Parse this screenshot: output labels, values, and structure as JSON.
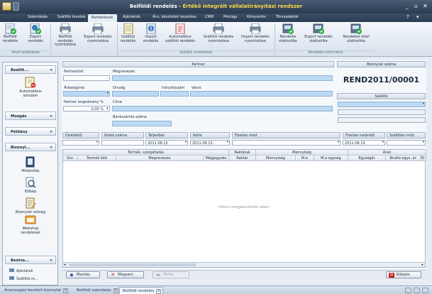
{
  "title": {
    "prefix": "Belföldi rendelés",
    "sep": " - ",
    "app": "Értékő integrált vállalatirányítási rendszer"
  },
  "window_controls": {
    "minimize": "_",
    "restore": "▫",
    "close": "✕"
  },
  "menu": [
    "Számlázás",
    "Szállító levelek",
    "Rendelések",
    "Ajánlatok",
    "Áru, készletek kezelése",
    "CRM",
    "Pénügy",
    "Könyvelés",
    "Törzsadatok"
  ],
  "ribbon": {
    "buttons": [
      {
        "label": "Belföldi\nrendelés"
      },
      {
        "label": "Export\nrendelés"
      },
      {
        "label": "Belföldi rendelés\nnyomtatása"
      },
      {
        "label": "Export rendelés\nnyomtatása"
      },
      {
        "label": "Szállítói\nrendelés"
      },
      {
        "label": "Import\nrendelés"
      },
      {
        "label": "Automatikus\nszállítói rendelés"
      },
      {
        "label": "Szállítói rendelés\nnyomtatása"
      },
      {
        "label": "Import rendelés\nnyomtatása"
      },
      {
        "label": "Rendelés\nstatisztika"
      },
      {
        "label": "Export rendelés\nstatisztika"
      },
      {
        "label": "Rendelési tétel\nstatisztika"
      }
    ],
    "groups": [
      "Vevő rendelések",
      "Szállítói rendelések",
      "Rendelés információ"
    ]
  },
  "left_panel": {
    "sections": [
      {
        "title": "Beállít...",
        "chevron": "«"
      },
      {
        "title": "Mozgás",
        "chevron": "»"
      },
      {
        "title": "Példány",
        "chevron": "»"
      },
      {
        "title": "Bizonyl...",
        "chevron": "«"
      },
      {
        "title": "Beolva...",
        "chevron": "«"
      }
    ],
    "items": {
      "auto": "Automatikus\nsorszám",
      "modositas": "Módosítás",
      "elokep": "Előkép",
      "szoveg": "Bizonylat szöveg",
      "webshop": "Webshop\nrendelések",
      "ajanlatok": "Ajánlatok",
      "szallito_re": "Szállítói re..."
    }
  },
  "partner": {
    "header": "Partner",
    "partnerkod": "Partnerkód",
    "megnevezes": "Megnevezés",
    "arkategoria": "Árkategória",
    "orszag": "Ország",
    "iranyitoszam": "Irányítószám",
    "varos": "Város",
    "engedmeny": "Partner engedmény %",
    "engedmeny_value": "0,00 %",
    "cime": "Címe",
    "bankszamla": "Bankszámla száma"
  },
  "bizonylat": {
    "header": "Bizonylat száma",
    "value": "REND2011/00001"
  },
  "szallito": {
    "header": "Szállító"
  },
  "fields": {
    "uzletkoto": "Üzletkötő",
    "iktato": "Iktató száma",
    "teljesites": "Teljesítés",
    "teljesites_value": "2011.08.15.",
    "kelte": "Kelte",
    "kelte_value": "2011.08.15.",
    "fizetesi_mod": "Fizetési mód",
    "fizetesi_hatarido": "Fizetési határidő",
    "fizetesi_hatarido_value": "2011.08.15.",
    "szallitasi_mod": "Szállítási mód"
  },
  "grid": {
    "group_headers": [
      "Termék, szolgáltatás",
      "Raktárak",
      "Mennyiség",
      "Árak"
    ],
    "columns": [
      "Sor.",
      "Termék kód",
      "Megnevezés",
      "Megjegyzés",
      "Raktár",
      "Mennyiség",
      "M.e",
      "M.e egység",
      "Egységár",
      "Bruttó egys. ár",
      "Er"
    ],
    "empty_text": "<Nincs megjeleníthető adat>"
  },
  "buttons": {
    "save": "Mentés",
    "cancel": "Mégsem",
    "delete": "Törlés",
    "exit": "Kilépés"
  },
  "status_tabs": [
    "Árumozgási bevételi bizonylat",
    "Belföldi számlázás",
    "Belföldi rendelés"
  ]
}
